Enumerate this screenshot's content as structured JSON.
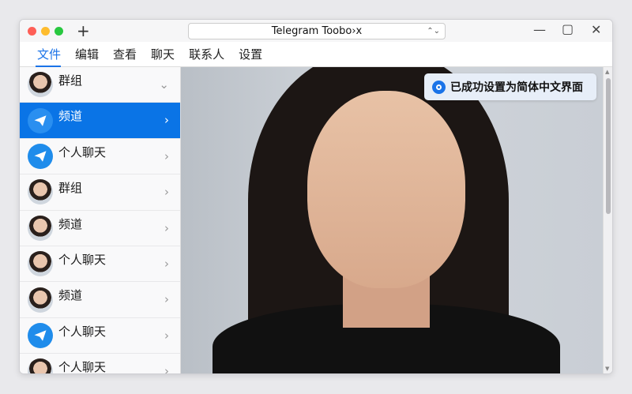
{
  "window": {
    "title": "Telegram Toobo›x"
  },
  "menu": [
    {
      "label": "文件",
      "active": true
    },
    {
      "label": "编辑"
    },
    {
      "label": "查看"
    },
    {
      "label": "聊天"
    },
    {
      "label": "联系人"
    },
    {
      "label": "设置"
    }
  ],
  "sidebar": {
    "items": [
      {
        "label": "群组",
        "avatar": "face"
      },
      {
        "label": "频道",
        "avatar": "telegram",
        "selected": true
      },
      {
        "label": "个人聊天",
        "avatar": "telegram"
      },
      {
        "label": "群组",
        "avatar": "face"
      },
      {
        "label": "频道",
        "avatar": "face"
      },
      {
        "label": "个人聊天",
        "avatar": "face"
      },
      {
        "label": "频道",
        "avatar": "face"
      },
      {
        "label": "个人聊天",
        "avatar": "telegram"
      },
      {
        "label": "个人聊天",
        "avatar": "face"
      }
    ]
  },
  "toast": {
    "text": "已成功设置为简体中文界面"
  },
  "colors": {
    "accent": "#0a74e6"
  }
}
